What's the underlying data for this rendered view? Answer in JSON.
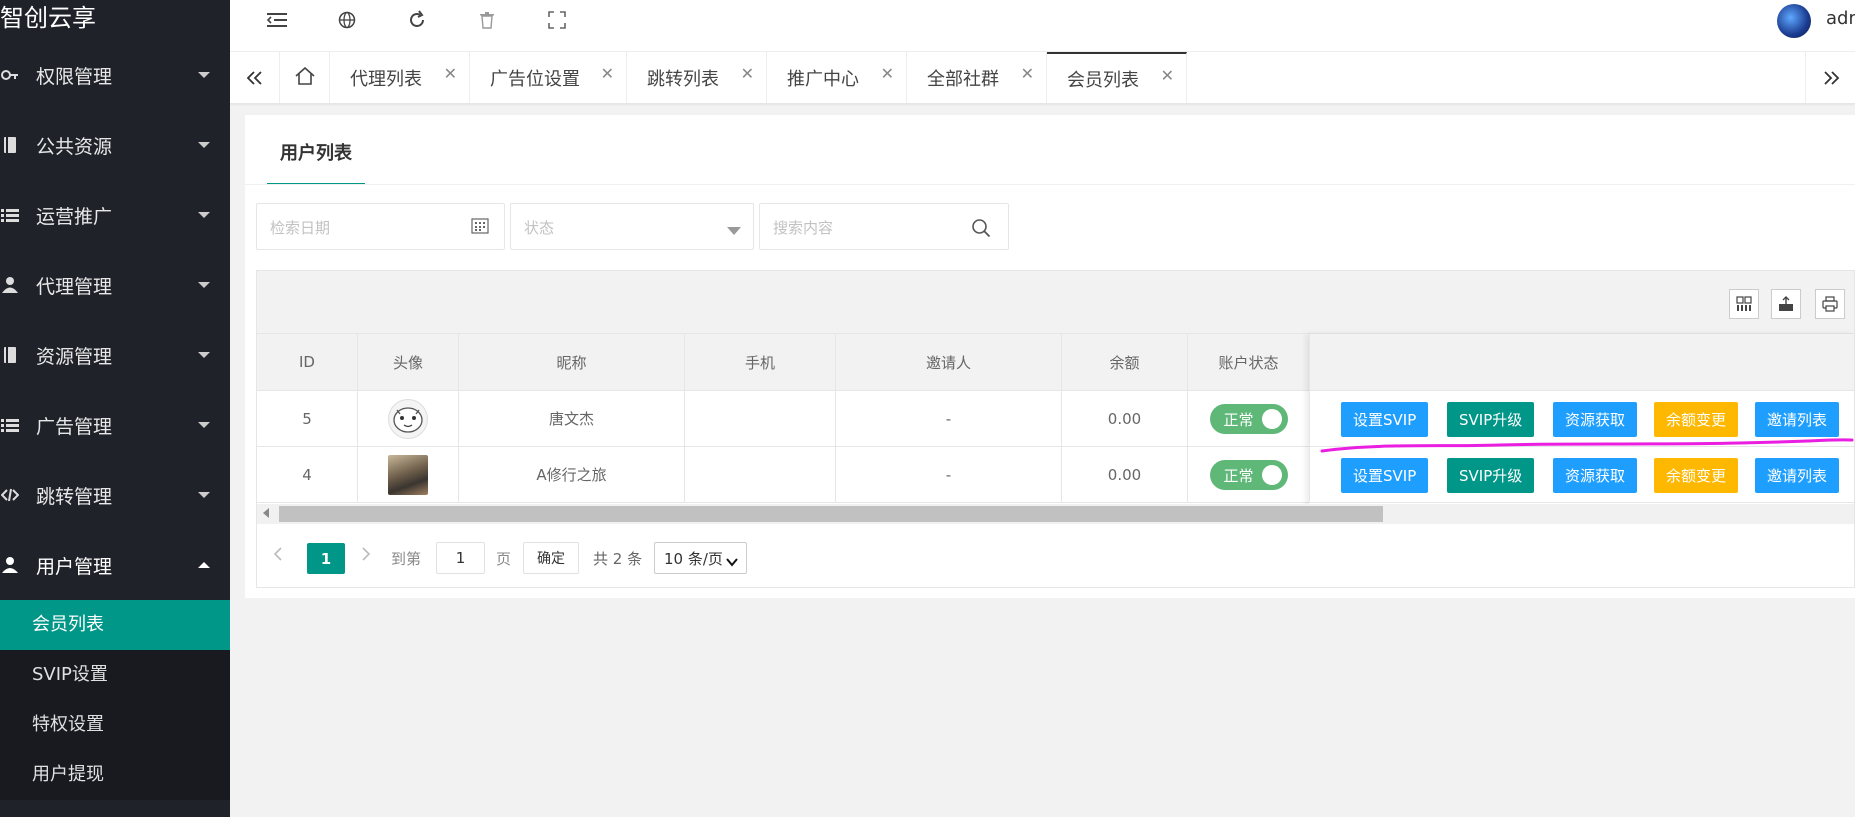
{
  "app": {
    "title": "智创云享",
    "user_name": "admin"
  },
  "sidebar": {
    "items": [
      {
        "label": "权限管理",
        "icon": "key-icon"
      },
      {
        "label": "公共资源",
        "icon": "book-icon"
      },
      {
        "label": "运营推广",
        "icon": "list-icon"
      },
      {
        "label": "代理管理",
        "icon": "agent-icon"
      },
      {
        "label": "资源管理",
        "icon": "book-icon"
      },
      {
        "label": "广告管理",
        "icon": "list-icon"
      },
      {
        "label": "跳转管理",
        "icon": "code-icon"
      },
      {
        "label": "用户管理",
        "icon": "user-icon"
      }
    ],
    "sub_items": [
      "会员列表",
      "SVIP设置",
      "特权设置",
      "用户提现"
    ]
  },
  "tabs": {
    "items": [
      "代理列表",
      "广告位设置",
      "跳转列表",
      "推广中心",
      "全部社群",
      "会员列表"
    ],
    "active": "会员列表",
    "close_glyph": "✕"
  },
  "card": {
    "title": "用户列表"
  },
  "filters": {
    "date_placeholder": "检索日期",
    "status_placeholder": "状态",
    "search_placeholder": "搜索内容"
  },
  "table": {
    "columns": [
      "ID",
      "头像",
      "昵称",
      "手机",
      "邀请人",
      "余额",
      "账户状态"
    ],
    "rows": [
      {
        "id": "5",
        "nickname": "唐文杰",
        "phone": "",
        "inviter": "-",
        "balance": "0.00",
        "status": "正常"
      },
      {
        "id": "4",
        "nickname": "A修行之旅",
        "phone": "",
        "inviter": "-",
        "balance": "0.00",
        "status": "正常"
      }
    ],
    "actions": [
      "设置SVIP",
      "SVIP升级",
      "资源获取",
      "余额变更",
      "邀请列表"
    ]
  },
  "pager": {
    "current": "1",
    "goto_label": "到第",
    "page_input": "1",
    "page_unit": "页",
    "confirm": "确定",
    "total": "共 2 条",
    "page_size": "10 条/页"
  },
  "colors": {
    "sidebar_bg": "#20222a",
    "accent": "#009688",
    "btn_blue": "#1e9fff",
    "btn_green": "#009688",
    "btn_orange": "#ffb800",
    "switch_on": "#5fb878",
    "annotation": "#e91ee0"
  }
}
